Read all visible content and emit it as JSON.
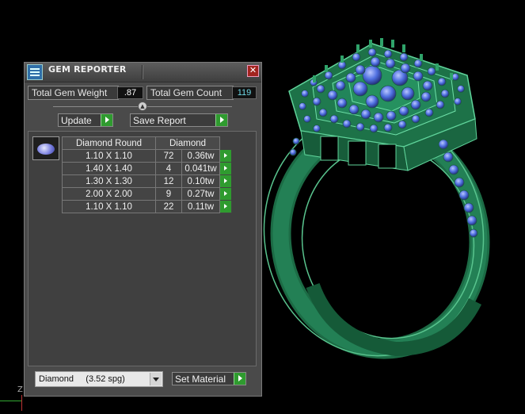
{
  "panel": {
    "title": "GEM REPORTER",
    "close_glyph": "✕",
    "total_weight_label": "Total Gem Weight",
    "total_weight_value": ".87",
    "total_count_label": "Total Gem Count",
    "total_count_value": "119",
    "update_label": "Update",
    "save_report_label": "Save Report",
    "table": {
      "headers": [
        "Diamond Round",
        "Diamond"
      ],
      "rows": [
        {
          "size": "1.10 X 1.10",
          "count": "72",
          "weight": "0.36tw"
        },
        {
          "size": "1.40 X 1.40",
          "count": "4",
          "weight": "0.041tw"
        },
        {
          "size": "1.30 X 1.30",
          "count": "12",
          "weight": "0.10tw"
        },
        {
          "size": "2.00 X 2.00",
          "count": "9",
          "weight": "0.27tw"
        },
        {
          "size": "1.10 X 1.10",
          "count": "22",
          "weight": "0.11tw"
        }
      ]
    },
    "material_select_value": "Diamond     (3.52 spg)",
    "set_material_label": "Set Material"
  },
  "viewport": {
    "axis_label": "Z"
  },
  "colors": {
    "ring_green": "#1f7a4f",
    "gem_blue": "#4f6fe0",
    "accent_green": "#2f9b2f",
    "close_red": "#a3241f"
  }
}
